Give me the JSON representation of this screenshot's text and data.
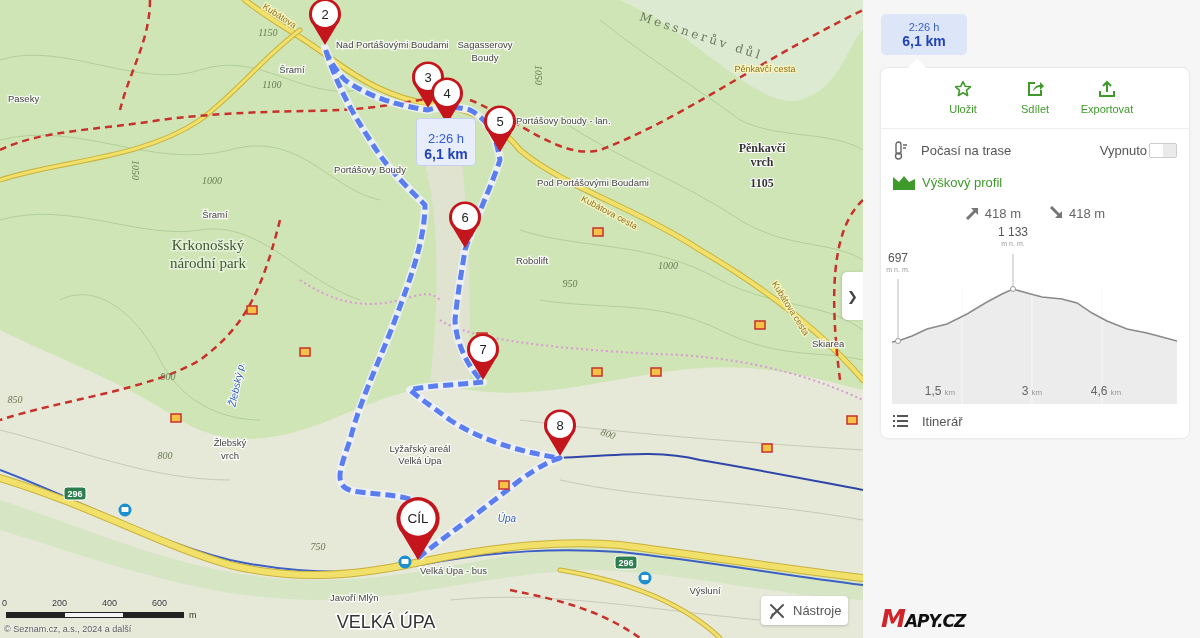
{
  "map": {
    "labels": [
      {
        "text": "Kubátova",
        "kind": "road"
      },
      {
        "text": "Nad Portášovými Boudami",
        "kind": "poi"
      },
      {
        "text": "Sagasserovy",
        "kind": "poi"
      },
      {
        "text": "Boudy",
        "kind": "poi"
      },
      {
        "text": "Messnerův důl",
        "kind": "valley"
      },
      {
        "text": "Pěnkavčí cesta",
        "kind": "road"
      },
      {
        "text": "Pěnkavčí",
        "kind": "peak"
      },
      {
        "text": "vrch",
        "kind": "peak"
      },
      {
        "text": "1105",
        "kind": "peak"
      },
      {
        "text": "Portášovy boudy - lan.",
        "kind": "poi"
      },
      {
        "text": "Pod Portášovými Boudami",
        "kind": "poi"
      },
      {
        "text": "Kubátova cesta",
        "kind": "road"
      },
      {
        "text": "Kubátova cesta",
        "kind": "road"
      },
      {
        "text": "Paseky",
        "kind": "poi"
      },
      {
        "text": "Šramí",
        "kind": "poi"
      },
      {
        "text": "Šramí",
        "kind": "poi"
      },
      {
        "text": "Krkonošský",
        "kind": "area"
      },
      {
        "text": "národní park",
        "kind": "area"
      },
      {
        "text": "Robolift",
        "kind": "poi"
      },
      {
        "text": "Lyžařský areál",
        "kind": "poi"
      },
      {
        "text": "Velká Úpa",
        "kind": "poi"
      },
      {
        "text": "Úpa",
        "kind": "water"
      },
      {
        "text": "Velká Úpa - bus",
        "kind": "poi"
      },
      {
        "text": "Javoří Mlýn",
        "kind": "poi"
      },
      {
        "text": "VELKÁ ÚPA",
        "kind": "town"
      },
      {
        "text": "Výsluní",
        "kind": "poi"
      },
      {
        "text": "Skiarea",
        "kind": "poi"
      },
      {
        "text": "Žlebský",
        "kind": "poi"
      },
      {
        "text": "vrch",
        "kind": "poi"
      },
      {
        "text": "Žlebský p.",
        "kind": "water"
      },
      {
        "text": "Portášovy Boudy",
        "kind": "poi"
      },
      {
        "text": "1150",
        "kind": "contour"
      },
      {
        "text": "1100",
        "kind": "contour"
      },
      {
        "text": "1050",
        "kind": "contour"
      },
      {
        "text": "1000",
        "kind": "contour"
      },
      {
        "text": "1050",
        "kind": "contour"
      },
      {
        "text": "950",
        "kind": "contour"
      },
      {
        "text": "1000",
        "kind": "contour"
      },
      {
        "text": "900",
        "kind": "contour"
      },
      {
        "text": "850",
        "kind": "contour"
      },
      {
        "text": "800",
        "kind": "contour"
      },
      {
        "text": "800",
        "kind": "contour"
      },
      {
        "text": "750",
        "kind": "contour"
      },
      {
        "text": "296",
        "kind": "shield"
      },
      {
        "text": "296",
        "kind": "shield"
      }
    ],
    "markers": [
      {
        "label": "2",
        "kind": "waypoint"
      },
      {
        "label": "3",
        "kind": "waypoint"
      },
      {
        "label": "4",
        "kind": "waypoint"
      },
      {
        "label": "5",
        "kind": "waypoint"
      },
      {
        "label": "6",
        "kind": "waypoint"
      },
      {
        "label": "7",
        "kind": "waypoint"
      },
      {
        "label": "8",
        "kind": "waypoint"
      },
      {
        "label": "CÍL",
        "kind": "finish"
      }
    ],
    "route_tooltip": {
      "time": "2:26 h",
      "distance": "6,1 km"
    },
    "scale": {
      "ticks": [
        "0",
        "200",
        "400",
        "600"
      ],
      "unit": "m"
    },
    "copyright": "© Seznam.cz, a.s., 2024 a další",
    "tools_button": "Nástroje",
    "collapse_button": "❯",
    "logo": "MAPY.CZ"
  },
  "sidebar": {
    "summary_tab": {
      "time": "2:26 h",
      "distance": "6,1 km",
      "selected": true
    },
    "actions": [
      {
        "label": "Uložit",
        "kind": "save"
      },
      {
        "label": "Sdílet",
        "kind": "share"
      },
      {
        "label": "Exportovat",
        "kind": "export"
      }
    ],
    "weather": {
      "label": "Počasí na trase",
      "state_text": "Vypnuto",
      "on": false
    },
    "profile": {
      "title": "Výškový profil",
      "ascent": "418 m",
      "descent": "418 m",
      "points": [
        {
          "value": "697",
          "unit": "m n. m."
        },
        {
          "value": "1 133",
          "unit": "m n. m."
        }
      ],
      "distance_labels": [
        {
          "value": "1,5",
          "unit": "km"
        },
        {
          "value": "3",
          "unit": "km"
        },
        {
          "value": "4,6",
          "unit": "km"
        }
      ]
    },
    "itinerary": "Itinerář"
  }
}
